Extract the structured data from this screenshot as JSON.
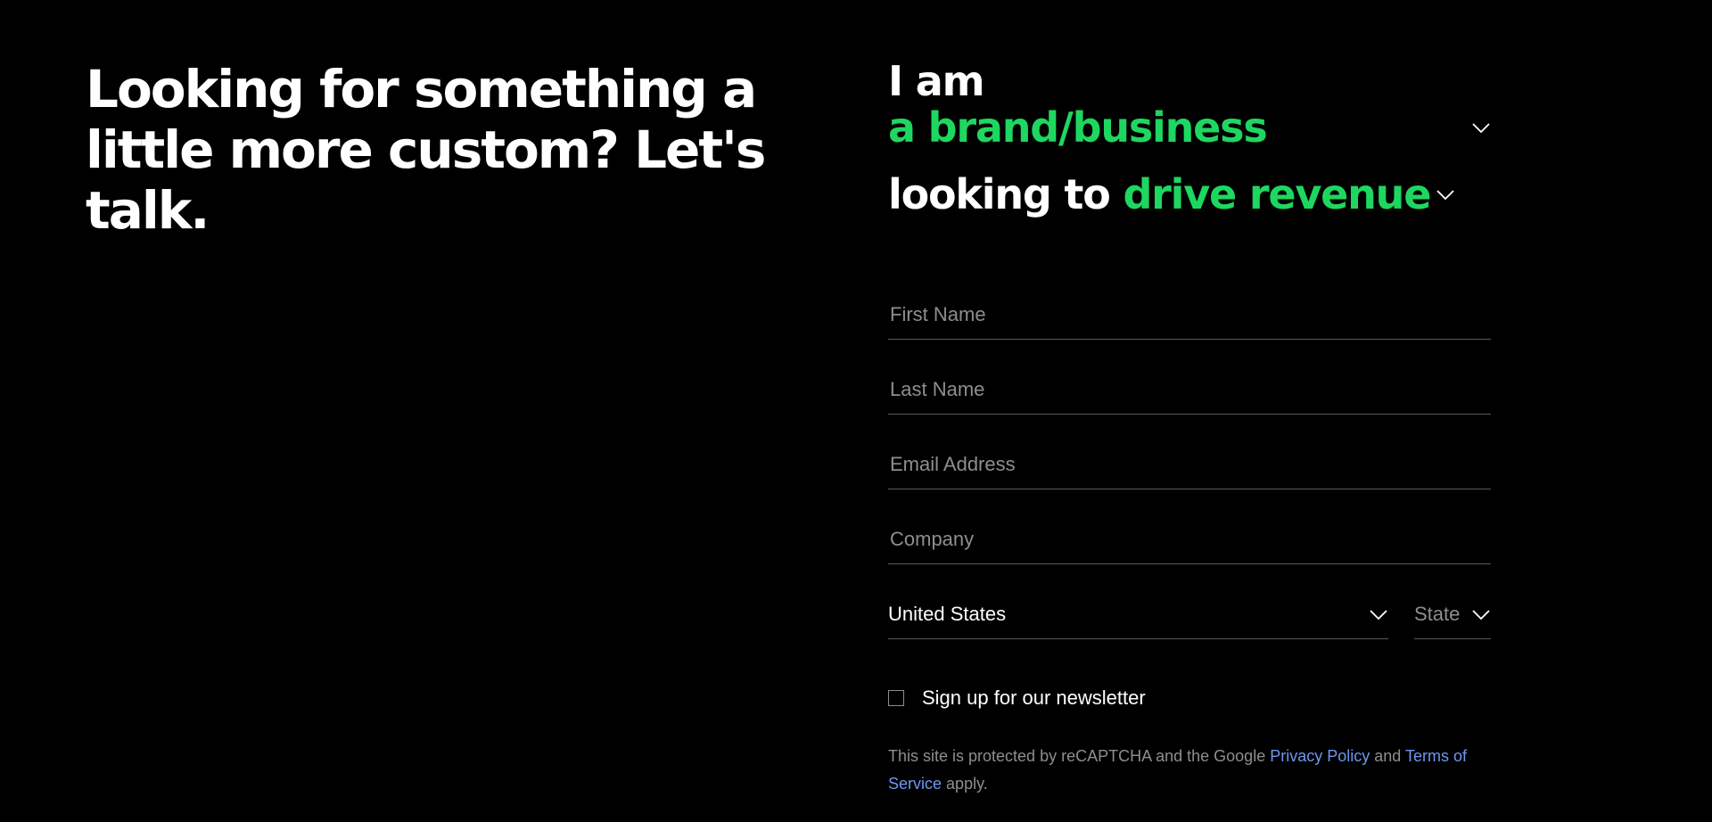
{
  "headline": "Looking for something a little more custom? Let's talk.",
  "selector": {
    "prefix": "I am",
    "audience_value": "a brand/business",
    "goal_prefix": "looking to",
    "goal_value": "drive revenue"
  },
  "form": {
    "first_name_placeholder": "First Name",
    "last_name_placeholder": "Last Name",
    "email_placeholder": "Email Address",
    "company_placeholder": "Company",
    "country_value": "United States",
    "state_placeholder": "State",
    "newsletter_label": "Sign up for our newsletter",
    "newsletter_checked": false
  },
  "legal": {
    "text_before": "This site is protected by reCAPTCHA and the Google",
    "privacy_link": "Privacy Policy",
    "and_text": "and",
    "terms_link": "Terms of Service",
    "text_after": "apply."
  },
  "icons": {
    "dropdown": "chevron-down-icon"
  },
  "colors": {
    "background": "#000000",
    "accent_green": "#1ed760",
    "link_blue": "#6e97f0",
    "muted_text": "#8e8e8e",
    "divider": "#5a5a5a"
  }
}
